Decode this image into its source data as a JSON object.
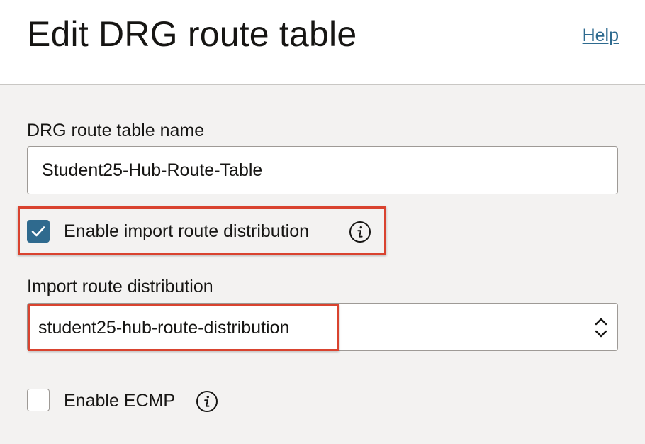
{
  "header": {
    "title": "Edit DRG route table",
    "help_label": "Help"
  },
  "form": {
    "name_label": "DRG route table name",
    "name_value": "Student25-Hub-Route-Table",
    "enable_import": {
      "label": "Enable import route distribution",
      "checked": true
    },
    "import_label": "Import route distribution",
    "import_value": "student25-hub-route-distribution",
    "enable_ecmp": {
      "label": "Enable ECMP",
      "checked": false
    }
  },
  "icons": {
    "checkmark": "check-icon",
    "info": "info-icon",
    "select_arrows": "chevron-up-down-icon"
  },
  "colors": {
    "accent": "#2f6a8e",
    "link": "#2d6a8f",
    "highlight_border": "#d9432f",
    "background": "#f3f2f1",
    "header_background": "#ffffff"
  }
}
